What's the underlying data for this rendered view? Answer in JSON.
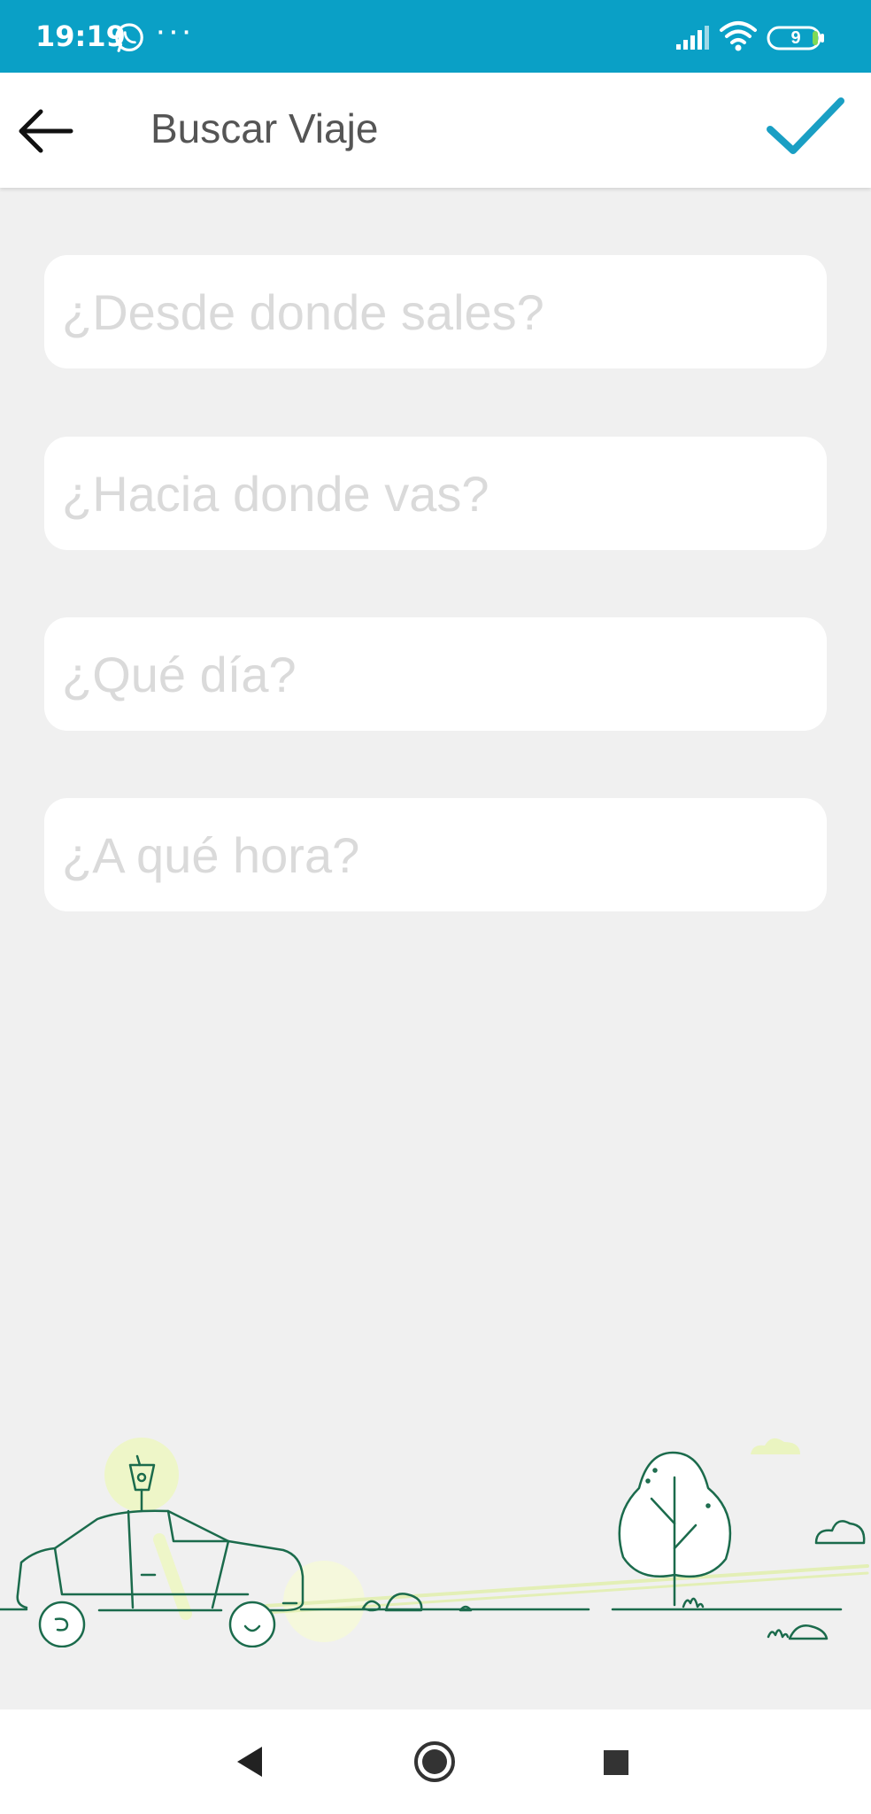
{
  "status_bar": {
    "time": "19:19",
    "more_indicator": "···",
    "battery_level": "9",
    "icons": [
      "whatsapp-icon",
      "signal-icon",
      "wifi-icon",
      "battery-icon"
    ]
  },
  "header": {
    "title": "Buscar Viaje",
    "back_icon": "arrow-left-icon",
    "confirm_icon": "checkmark-icon"
  },
  "form": {
    "origin": {
      "value": "",
      "placeholder": "¿Desde donde sales?"
    },
    "destination": {
      "value": "",
      "placeholder": "¿Hacia donde vas?"
    },
    "date": {
      "value": "",
      "placeholder": "¿Qué día?"
    },
    "time": {
      "value": "",
      "placeholder": "¿A qué hora?"
    }
  },
  "colors": {
    "status_bar": "#0aa0c6",
    "accent": "#1a9fc4",
    "illustration_stroke": "#1b6b4c",
    "illustration_highlight": "#eef6c8",
    "placeholder": "#dadada"
  },
  "nav_bar": {
    "icons": [
      "nav-back-icon",
      "nav-home-icon",
      "nav-recents-icon"
    ]
  }
}
